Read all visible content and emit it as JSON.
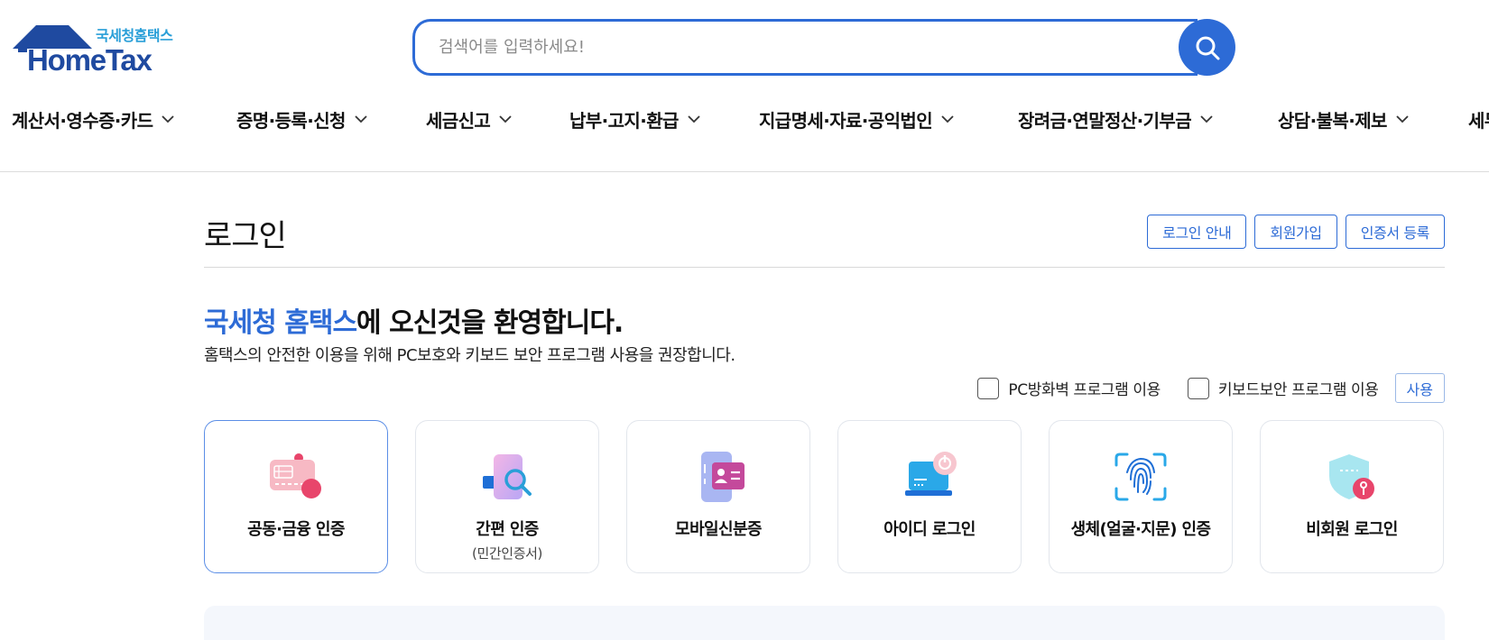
{
  "logo": {
    "sub": "국세청홈택스",
    "main": "HomeTax"
  },
  "search": {
    "placeholder": "검색어를 입력하세요!",
    "value": ""
  },
  "gnb": {
    "items": [
      {
        "label": "계산서·영수증·카드"
      },
      {
        "label": "증명·등록·신청"
      },
      {
        "label": "세금신고"
      },
      {
        "label": "납부·고지·환급"
      },
      {
        "label": "지급명세·자료·공익법인"
      },
      {
        "label": "장려금·연말정산·기부금"
      },
      {
        "label": "상담·불복·제보"
      },
      {
        "label": "세무"
      }
    ]
  },
  "login": {
    "title": "로그인",
    "buttons": {
      "guide": "로그인 안내",
      "join": "회원가입",
      "cert": "인증서 등록"
    },
    "welcome_highlight": "국세청 홈택스",
    "welcome_rest": "에 오신것을 환영합니다.",
    "description": "홈택스의 안전한 이용을 위해 PC보호와 키보드 보안 프로그램 사용을 권장합니다.",
    "options": {
      "firewall": "PC방화벽 프로그램 이용",
      "keyboard": "키보드보안 프로그램 이용",
      "use": "사용"
    },
    "methods": [
      {
        "label": "공동·금융 인증",
        "sub": "",
        "icon": "certificate-card-icon"
      },
      {
        "label": "간편 인증",
        "sub": "(민간인증서)",
        "icon": "simple-auth-icon"
      },
      {
        "label": "모바일신분증",
        "sub": "",
        "icon": "mobile-id-icon"
      },
      {
        "label": "아이디 로그인",
        "sub": "",
        "icon": "laptop-power-icon"
      },
      {
        "label": "생체(얼굴·지문) 인증",
        "sub": "",
        "icon": "fingerprint-icon"
      },
      {
        "label": "비회원 로그인",
        "sub": "",
        "icon": "shield-key-icon"
      }
    ]
  },
  "colors": {
    "accent": "#2d6bd6",
    "logo_sub": "#2a9fd8",
    "logo_main": "#1f4aa0"
  }
}
